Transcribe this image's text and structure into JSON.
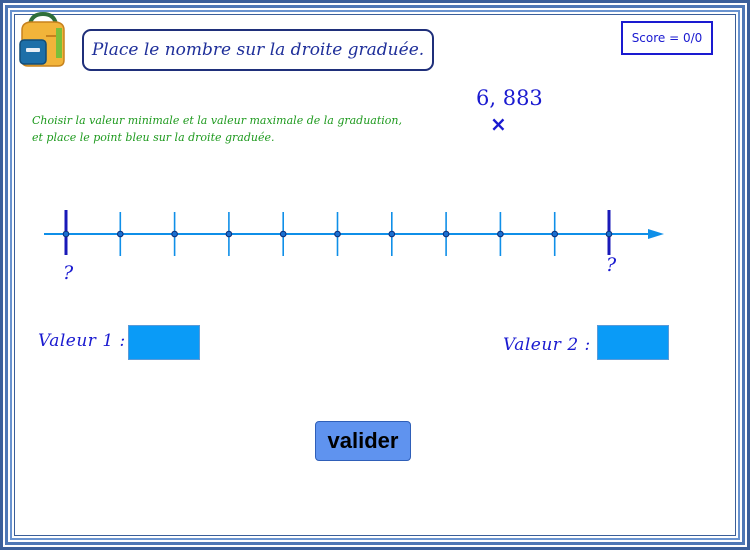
{
  "header": {
    "title": "Place le nombre sur la droite graduée.",
    "score": "Score = 0/0"
  },
  "instructions": {
    "line1": "Choisir la valeur minimale et la valeur maximale de la graduation,",
    "line2": "et place le point bleu sur la droite graduée."
  },
  "target": {
    "number": "6, 883",
    "marker": "×"
  },
  "number_line": {
    "min_label": "?",
    "max_label": "?",
    "graduations": 10
  },
  "inputs": {
    "value1_label": "Valeur 1 :",
    "value1": "",
    "value2_label": "Valeur 2 :",
    "value2": ""
  },
  "actions": {
    "validate_label": "valider"
  },
  "colors": {
    "axis": "#0f8fe8",
    "text_blue": "#1a1ad0",
    "instruction_green": "#1e9a1e",
    "input_fill": "#0a9bf7",
    "button": "#5f93ef"
  }
}
